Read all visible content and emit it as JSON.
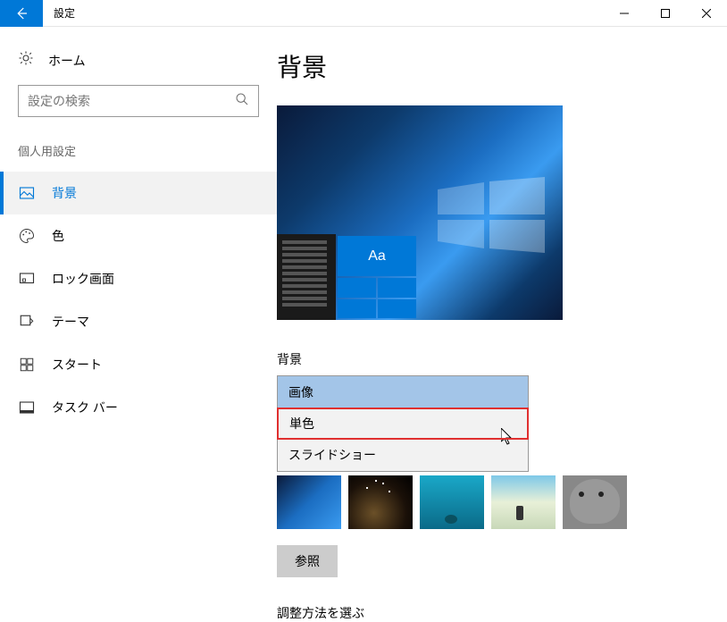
{
  "window": {
    "title": "設定"
  },
  "sidebar": {
    "home": "ホーム",
    "search_placeholder": "設定の検索",
    "section": "個人用設定",
    "items": [
      {
        "label": "背景"
      },
      {
        "label": "色"
      },
      {
        "label": "ロック画面"
      },
      {
        "label": "テーマ"
      },
      {
        "label": "スタート"
      },
      {
        "label": "タスク バー"
      }
    ]
  },
  "main": {
    "heading": "背景",
    "preview_tile_text": "Aa",
    "bg_label": "背景",
    "options": [
      "画像",
      "単色",
      "スライドショー"
    ],
    "browse": "参照",
    "fit_label": "調整方法を選ぶ"
  }
}
